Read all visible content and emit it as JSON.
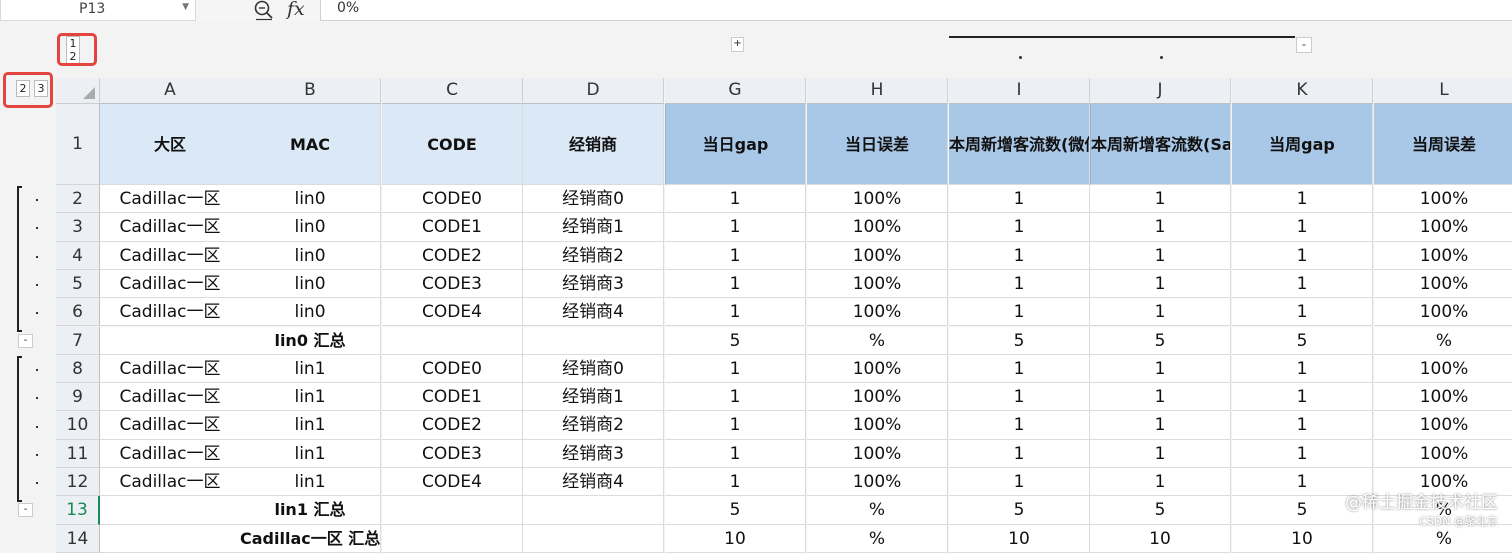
{
  "formula_bar": {
    "name_box": "P13",
    "formula": "0%"
  },
  "outline": {
    "col_levels": [
      "1",
      "2"
    ],
    "row_levels": [
      "2",
      "3"
    ],
    "plus": "+",
    "minus": "-"
  },
  "columns": [
    "A",
    "B",
    "C",
    "D",
    "G",
    "H",
    "I",
    "J",
    "K",
    "L"
  ],
  "header_row": {
    "row": "1",
    "cells": [
      "大区",
      "MAC",
      "CODE",
      "经销商",
      "当日gap",
      "当日误差",
      "本周新增客流数(微信",
      "本周新增客流数(Sale",
      "当周gap",
      "当周误差"
    ]
  },
  "rows": [
    {
      "row": "2",
      "cells": [
        "Cadillac一区",
        "lin0",
        "CODE0",
        "经销商0",
        "1",
        "100%",
        "1",
        "1",
        "1",
        "100%"
      ]
    },
    {
      "row": "3",
      "cells": [
        "Cadillac一区",
        "lin0",
        "CODE1",
        "经销商1",
        "1",
        "100%",
        "1",
        "1",
        "1",
        "100%"
      ]
    },
    {
      "row": "4",
      "cells": [
        "Cadillac一区",
        "lin0",
        "CODE2",
        "经销商2",
        "1",
        "100%",
        "1",
        "1",
        "1",
        "100%"
      ]
    },
    {
      "row": "5",
      "cells": [
        "Cadillac一区",
        "lin0",
        "CODE3",
        "经销商3",
        "1",
        "100%",
        "1",
        "1",
        "1",
        "100%"
      ]
    },
    {
      "row": "6",
      "cells": [
        "Cadillac一区",
        "lin0",
        "CODE4",
        "经销商4",
        "1",
        "100%",
        "1",
        "1",
        "1",
        "100%"
      ]
    },
    {
      "row": "7",
      "cells": [
        "",
        "lin0 汇总",
        "",
        "",
        "5",
        "%",
        "5",
        "5",
        "5",
        "%"
      ]
    },
    {
      "row": "8",
      "cells": [
        "Cadillac一区",
        "lin1",
        "CODE0",
        "经销商0",
        "1",
        "100%",
        "1",
        "1",
        "1",
        "100%"
      ]
    },
    {
      "row": "9",
      "cells": [
        "Cadillac一区",
        "lin1",
        "CODE1",
        "经销商1",
        "1",
        "100%",
        "1",
        "1",
        "1",
        "100%"
      ]
    },
    {
      "row": "10",
      "cells": [
        "Cadillac一区",
        "lin1",
        "CODE2",
        "经销商2",
        "1",
        "100%",
        "1",
        "1",
        "1",
        "100%"
      ]
    },
    {
      "row": "11",
      "cells": [
        "Cadillac一区",
        "lin1",
        "CODE3",
        "经销商3",
        "1",
        "100%",
        "1",
        "1",
        "1",
        "100%"
      ]
    },
    {
      "row": "12",
      "cells": [
        "Cadillac一区",
        "lin1",
        "CODE4",
        "经销商4",
        "1",
        "100%",
        "1",
        "1",
        "1",
        "100%"
      ]
    },
    {
      "row": "13",
      "cells": [
        "",
        "lin1 汇总",
        "",
        "",
        "5",
        "%",
        "5",
        "5",
        "5",
        "%"
      ]
    },
    {
      "row": "14",
      "cells": [
        "",
        "Cadillac一区 汇总",
        "",
        "",
        "10",
        "%",
        "10",
        "10",
        "10",
        "%"
      ]
    }
  ],
  "watermark": {
    "line1": "@稀土掘金技术社区",
    "line2": "CSDN @聚北东"
  }
}
